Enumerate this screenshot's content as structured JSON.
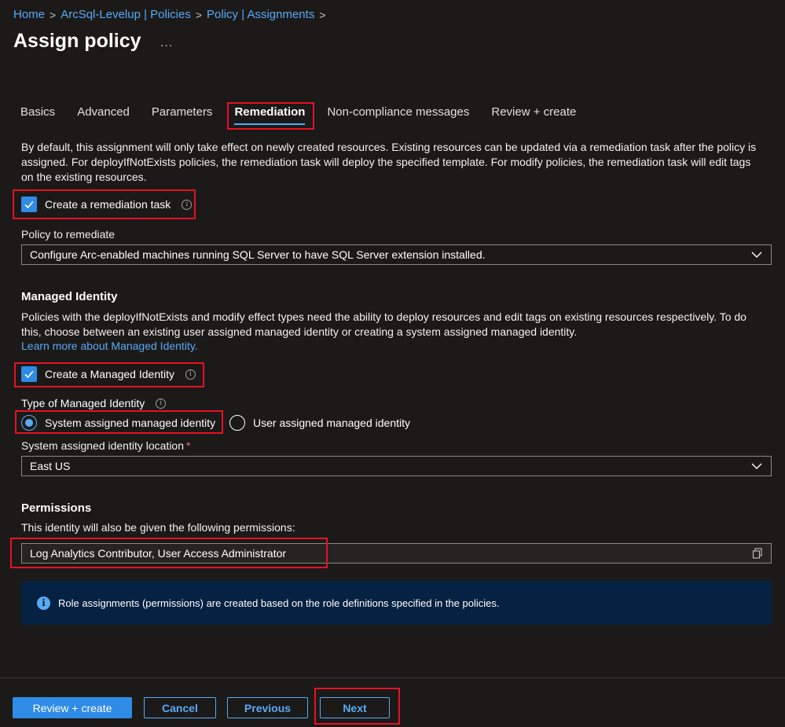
{
  "breadcrumb": [
    "Home",
    "ArcSql-Levelup | Policies",
    "Policy | Assignments"
  ],
  "page_title": "Assign policy",
  "more_label": "...",
  "tabs": [
    {
      "label": "Basics"
    },
    {
      "label": "Advanced"
    },
    {
      "label": "Parameters"
    },
    {
      "label": "Remediation"
    },
    {
      "label": "Non-compliance messages"
    },
    {
      "label": "Review + create"
    }
  ],
  "active_tab": "Remediation",
  "remediation": {
    "description": "By default, this assignment will only take effect on newly created resources. Existing resources can be updated via a remediation task after the policy is assigned. For deployIfNotExists policies, the remediation task will deploy the specified template. For modify policies, the remediation task will edit tags on the existing resources.",
    "create_task_label": "Create a remediation task",
    "create_task_checked": true,
    "policy_label": "Policy to remediate",
    "policy_value": "Configure Arc-enabled machines running SQL Server to have SQL Server extension installed."
  },
  "managed_identity": {
    "title": "Managed Identity",
    "description": "Policies with the deployIfNotExists and modify effect types need the ability to deploy resources and edit tags on existing resources respectively. To do this, choose between an existing user assigned managed identity or creating a system assigned managed identity.",
    "learn_more": "Learn more about Managed Identity.",
    "create_label": "Create a Managed Identity",
    "create_checked": true,
    "type_label": "Type of Managed Identity",
    "options": [
      "System assigned managed identity",
      "User assigned managed identity"
    ],
    "selected": "System assigned managed identity",
    "location_label": "System assigned identity location",
    "location_required": "*",
    "location_value": "East US"
  },
  "permissions": {
    "title": "Permissions",
    "description": "This identity will also be given the following permissions:",
    "value": "Log Analytics Contributor, User Access Administrator",
    "info_text": "Role assignments (permissions) are created based on the role definitions specified in the policies."
  },
  "footer": {
    "review_create": "Review + create",
    "cancel": "Cancel",
    "previous": "Previous",
    "next": "Next"
  },
  "colors": {
    "background": "#1b1a19",
    "accent": "#2f8be6",
    "link": "#5aa9f5",
    "highlight": "#e81123",
    "info_bar": "#062242"
  }
}
